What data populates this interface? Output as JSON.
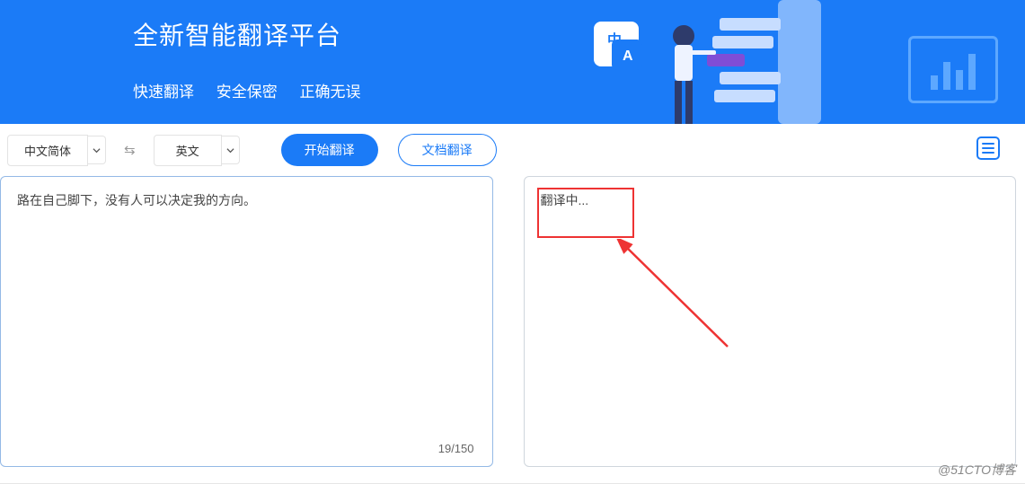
{
  "hero": {
    "title": "全新智能翻译平台",
    "features": [
      "快速翻译",
      "安全保密",
      "正确无误"
    ]
  },
  "toolbar": {
    "source_lang": "中文简体",
    "target_lang": "英文",
    "translate_btn": "开始翻译",
    "doc_btn": "文档翻译"
  },
  "input": {
    "text": "路在自己脚下，没有人可以决定我的方向。",
    "counter": "19/150"
  },
  "output": {
    "status": "翻译中..."
  },
  "watermark": "@51CTO博客"
}
